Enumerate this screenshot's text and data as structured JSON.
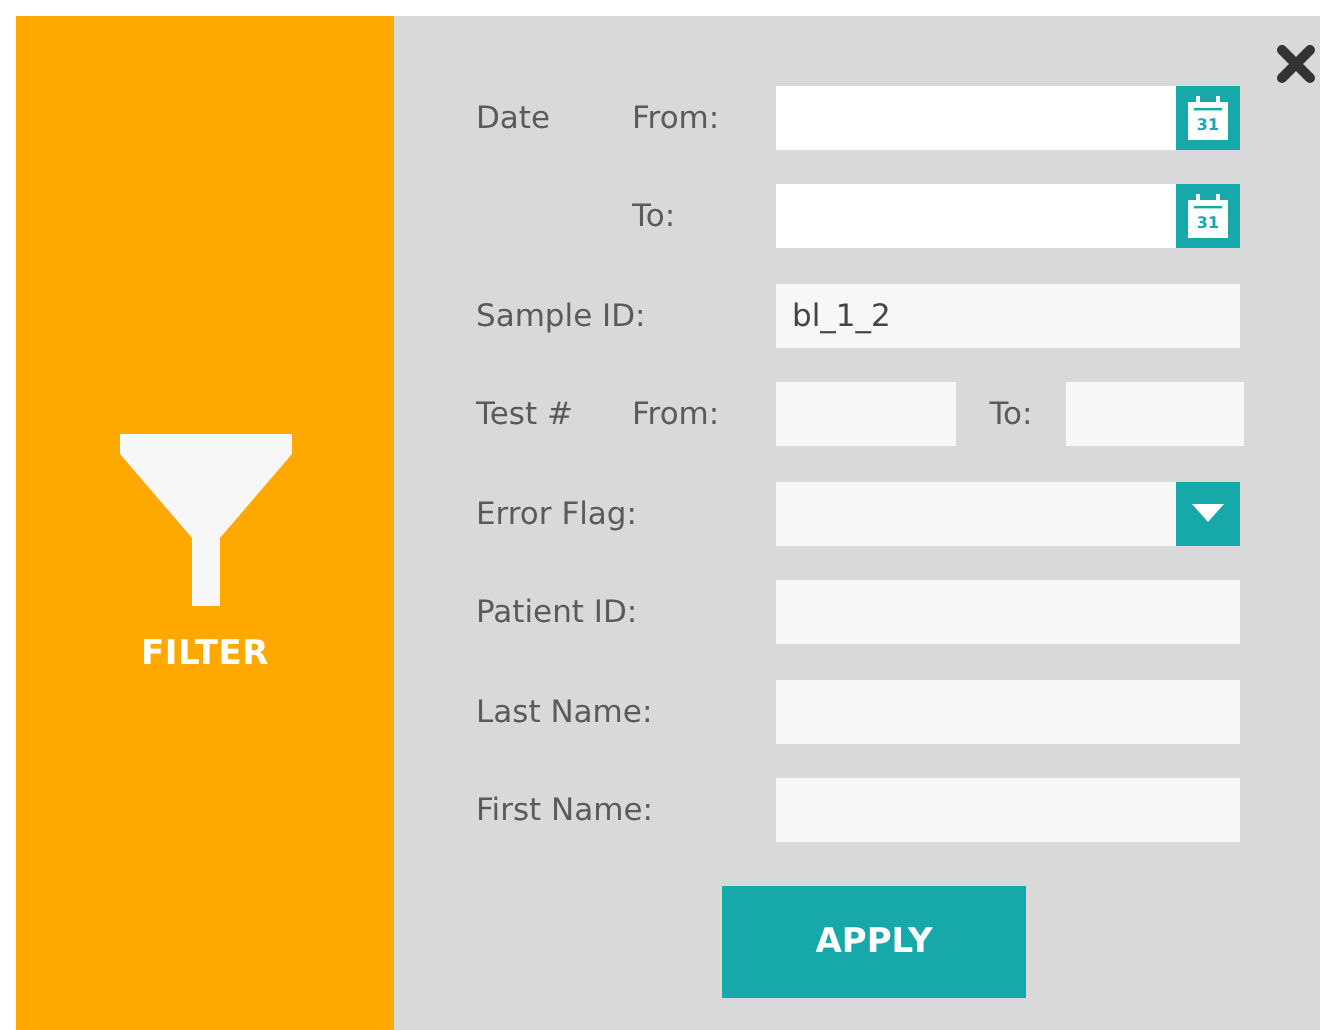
{
  "sidebar": {
    "title": "FILTER"
  },
  "fields": [
    {
      "kind": "date",
      "label": "Date",
      "sublabel": "From:",
      "icon_text": "31"
    },
    {
      "kind": "date",
      "sublabel": "To:",
      "icon_text": "31"
    },
    {
      "kind": "text",
      "label": "Sample ID:",
      "value": "bl_1_2"
    },
    {
      "kind": "range",
      "label": "Test #",
      "sublabel": "From:",
      "to_label": "To:"
    },
    {
      "kind": "dropdown",
      "label": "Error Flag:"
    },
    {
      "kind": "text",
      "label": "Patient ID:"
    },
    {
      "kind": "text",
      "label": "Last Name:"
    },
    {
      "kind": "text",
      "label": "First Name:"
    }
  ],
  "apply_button": "APPLY"
}
